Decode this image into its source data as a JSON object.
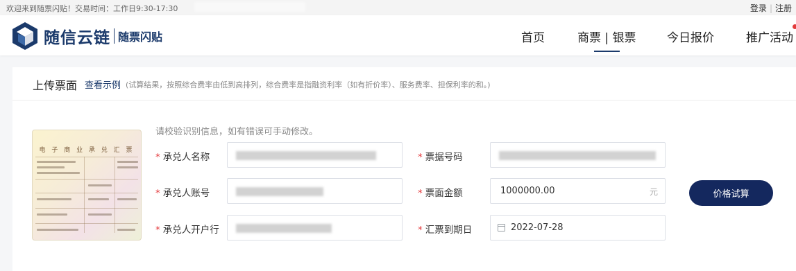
{
  "topbar": {
    "welcome": "欢迎来到随票闪贴！交易时间：工作日9:30-17:30",
    "login": "登录",
    "register": "注册"
  },
  "header": {
    "brand": "随信云链",
    "sub_brand": "随票闪贴",
    "nav": [
      {
        "label": "首页"
      },
      {
        "label": "商票 | 银票"
      },
      {
        "label": "今日报价"
      },
      {
        "label": "推广活动"
      }
    ]
  },
  "upload": {
    "title": "上传票面",
    "sample_link": "查看示例",
    "note": "(试算结果，按照综合费率由低到高排列，综合费率是指融资利率（如有折价率）、服务费率、担保利率的和。)",
    "bill_title": "电 子 商 业 承 兑 汇 票"
  },
  "form": {
    "hint": "请校验识别信息，如有错误可手动修改。",
    "acceptor_name_label": "承兑人名称",
    "acceptor_account_label": "承兑人账号",
    "acceptor_bank_label": "承兑人开户行",
    "bill_no_label": "票据号码",
    "amount_label": "票面金额",
    "amount_value": "1000000.00",
    "amount_unit": "元",
    "due_date_label": "汇票到期日",
    "due_date_value": "2022-07-28",
    "required_mark": "*",
    "calc_button": "价格试算"
  },
  "colors": {
    "brand": "#1b3a6b",
    "button": "#14285e",
    "required": "#e4393c"
  }
}
